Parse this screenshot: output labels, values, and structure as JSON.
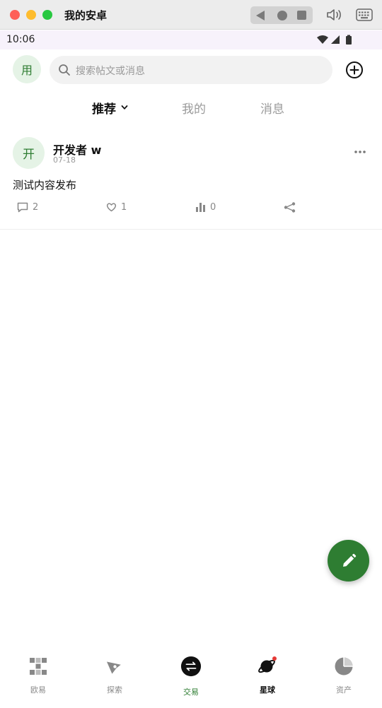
{
  "window": {
    "title": "我的安卓"
  },
  "status_bar": {
    "time": "10:06"
  },
  "header": {
    "avatar_char": "用",
    "search_placeholder": "搜索帖文或消息"
  },
  "tabs": [
    {
      "label": "推荐",
      "active": true
    },
    {
      "label": "我的",
      "active": false
    },
    {
      "label": "消息",
      "active": false
    }
  ],
  "post": {
    "avatar_char": "开",
    "author": "开发者 w",
    "date": "07-18",
    "content": "测试内容发布",
    "comments": "2",
    "likes": "1",
    "views": "0"
  },
  "bottom_nav": [
    {
      "label": "欧易",
      "icon": "okx-logo-icon"
    },
    {
      "label": "探索",
      "icon": "compass-icon"
    },
    {
      "label": "交易",
      "icon": "swap-icon"
    },
    {
      "label": "星球",
      "icon": "planet-icon"
    },
    {
      "label": "资产",
      "icon": "pie-chart-icon"
    }
  ],
  "colors": {
    "accent": "#2e7d32",
    "avatar_bg": "#e5f3e6",
    "status_bar_bg": "#f7f2fb"
  }
}
